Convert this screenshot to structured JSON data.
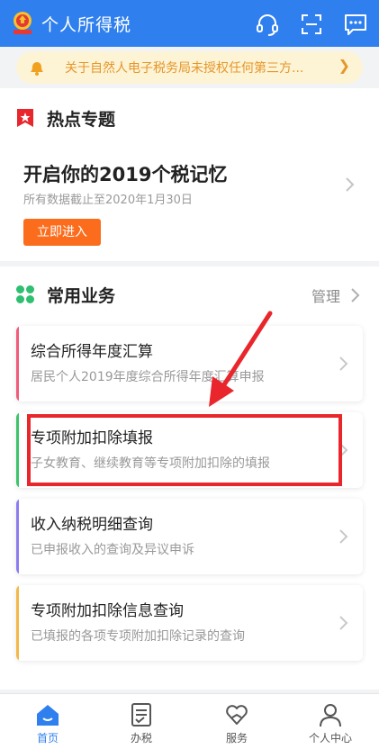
{
  "app": {
    "title": "个人所得税"
  },
  "notice": {
    "text": "关于自然人电子税务局未授权任何第三方..."
  },
  "hot_topics": {
    "section_title": "热点专题",
    "card_title": "开启你的2019个税记忆",
    "card_subtitle": "所有数据截止至2020年1月30日",
    "button_label": "立即进入"
  },
  "services": {
    "section_title": "常用业务",
    "manage_label": "管理",
    "items": [
      {
        "title": "综合所得年度汇算",
        "desc": "居民个人2019年度综合所得年度汇算申报",
        "accent": "#f25b7a"
      },
      {
        "title": "专项附加扣除填报",
        "desc": "子女教育、继续教育等专项附加扣除的填报",
        "accent": "#3cc46c"
      },
      {
        "title": "收入纳税明细查询",
        "desc": "已申报收入的查询及异议申诉",
        "accent": "#8b7cf0"
      },
      {
        "title": "专项附加扣除信息查询",
        "desc": "已填报的各项专项附加扣除记录的查询",
        "accent": "#f4b84a"
      }
    ]
  },
  "tabbar": {
    "tabs": [
      {
        "label": "首页",
        "icon": "home-icon",
        "active": true
      },
      {
        "label": "办税",
        "icon": "document-icon",
        "active": false
      },
      {
        "label": "服务",
        "icon": "heart-hand-icon",
        "active": false
      },
      {
        "label": "个人中心",
        "icon": "person-icon",
        "active": false
      }
    ]
  },
  "colors": {
    "brand": "#2f80ee",
    "button": "#fb6d1c",
    "highlight": "#e8262b",
    "notice_text": "#e5972b"
  }
}
